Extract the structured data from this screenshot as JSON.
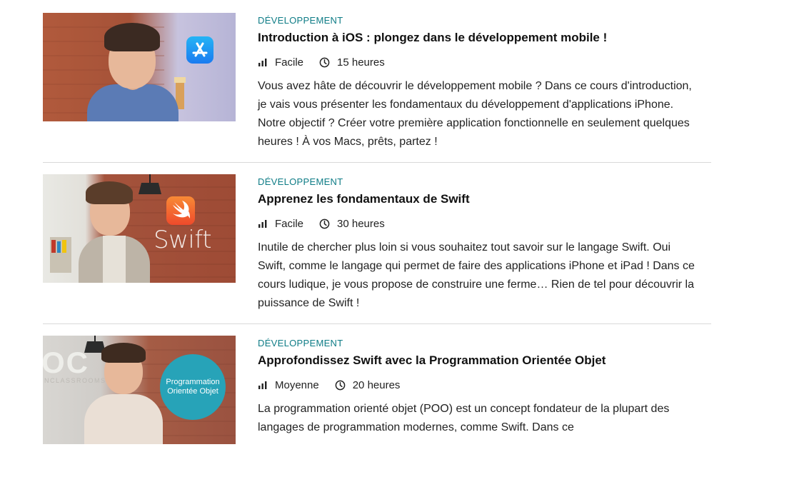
{
  "courses": [
    {
      "category": "DÉVELOPPEMENT",
      "title": "Introduction à iOS : plongez dans le développement mobile !",
      "level": "Facile",
      "level_bars": 1,
      "duration": "15 heures",
      "description": "Vous avez hâte de découvrir le développement mobile ? Dans ce cours d'introduction, je vais vous présenter les fondamentaux du développement d'applications iPhone. Notre objectif ? Créer votre première application fonctionnelle en seulement quelques heures ! À vos Macs, prêts, partez !",
      "thumbnail_icon": "app-store-icon"
    },
    {
      "category": "DÉVELOPPEMENT",
      "title": "Apprenez les fondamentaux de Swift",
      "level": "Facile",
      "level_bars": 1,
      "duration": "30 heures",
      "description": "Inutile de chercher plus loin si vous souhaitez tout savoir sur le langage Swift. Oui Swift, comme le langage qui permet de faire des applications iPhone et iPad ! Dans ce cours ludique, je vous propose de construire une ferme… Rien de tel pour découvrir la puissance de Swift !",
      "thumbnail_icon": "swift-logo-icon",
      "thumbnail_text": "Swift"
    },
    {
      "category": "DÉVELOPPEMENT",
      "title": "Approfondissez Swift avec la Programmation Orientée Objet",
      "level": "Moyenne",
      "level_bars": 2,
      "duration": "20 heures",
      "description": "La programmation orienté objet (POO) est un concept fondateur de la plupart des langages de programmation modernes, comme Swift. Dans ce",
      "thumbnail_badge": [
        "Programmation",
        "Orientée Objet"
      ],
      "thumbnail_wall_text": "OC",
      "thumbnail_wall_sub": "NCLASSROOMS"
    }
  ],
  "colors": {
    "category": "#0e7c86",
    "title": "#111111",
    "separator": "#d9d9d9",
    "badge": "#27a3b8"
  }
}
